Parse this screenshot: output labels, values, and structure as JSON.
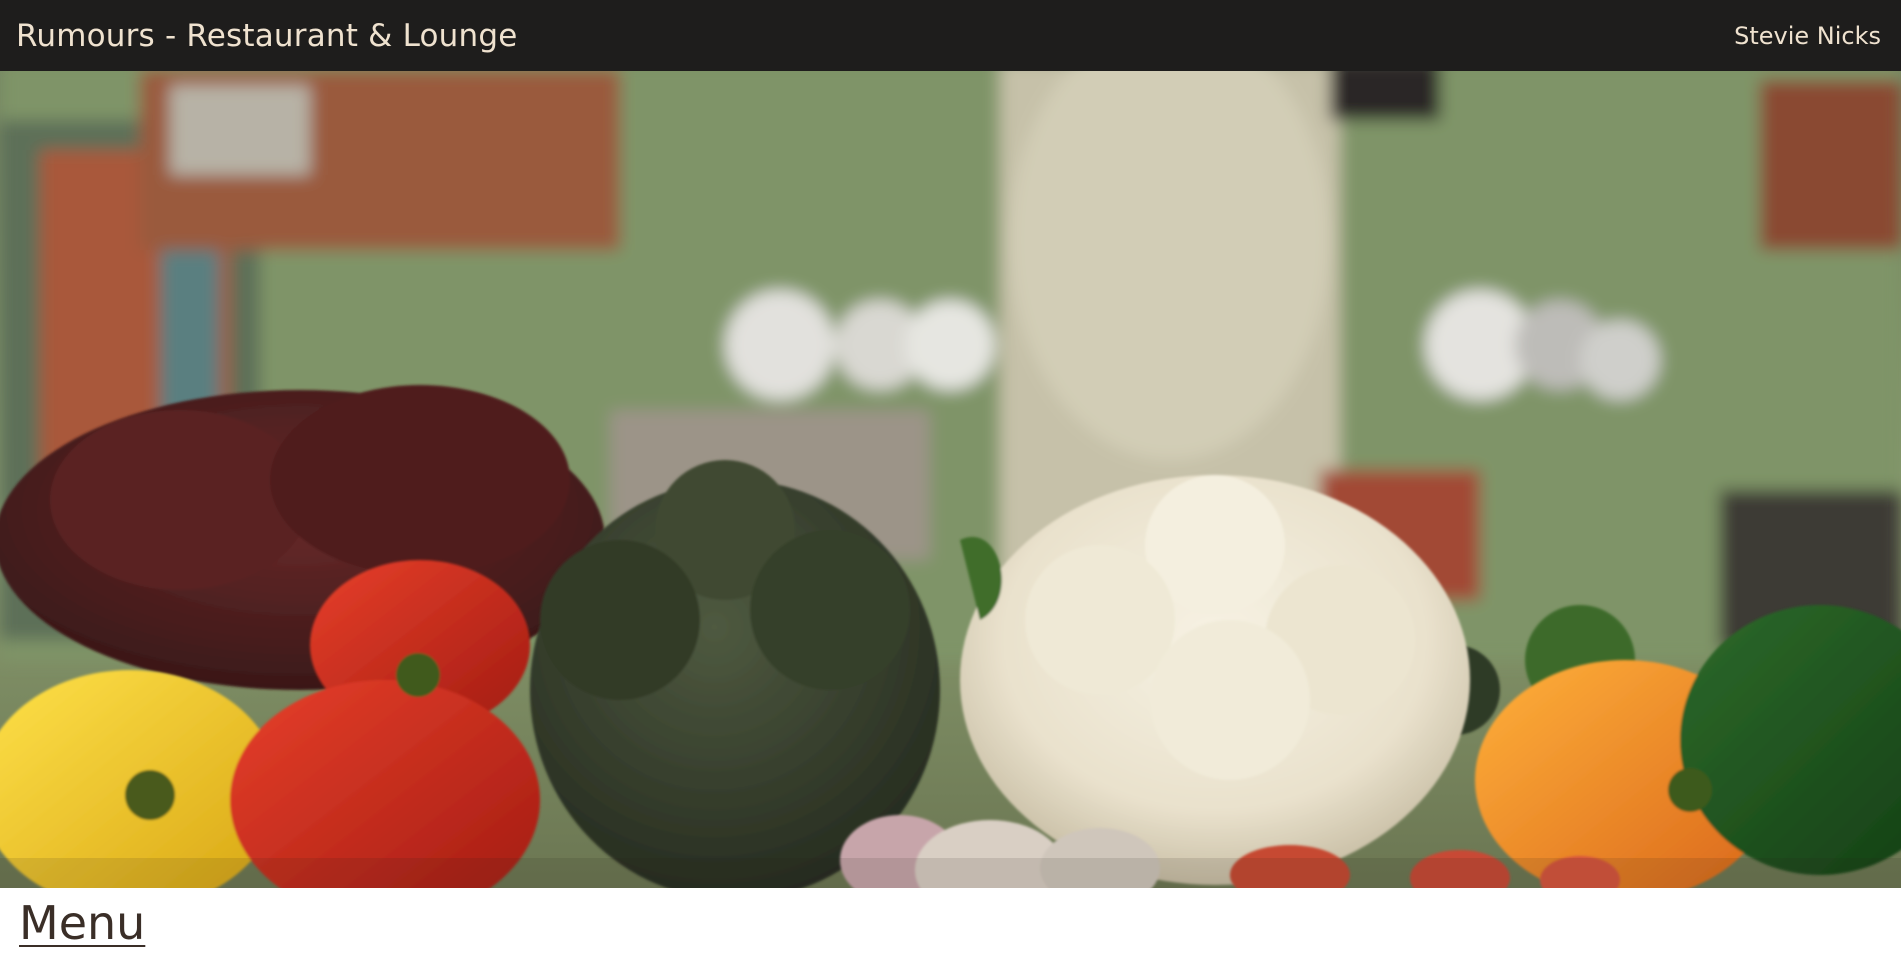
{
  "header": {
    "site_title": "Rumours - Restaurant & Lounge",
    "user_name": "Stevie Nicks"
  },
  "hero": {
    "image_subject": "kitchen-vegetables-photo"
  },
  "main": {
    "menu_link_label": "Menu"
  },
  "colors": {
    "header_bg": "#1e1d1c",
    "header_text": "#efe2cf",
    "menu_link": "#3a2e27",
    "page_bg": "#ffffff"
  }
}
